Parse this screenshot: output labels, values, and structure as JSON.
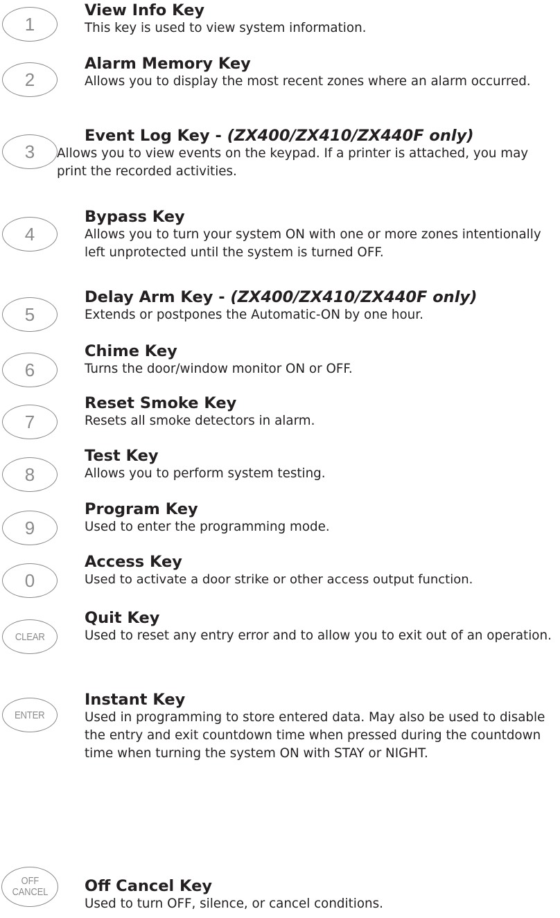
{
  "keys": [
    {
      "button": "1",
      "title": "View Info Key",
      "title_note": "",
      "description": "This key is used to view system information."
    },
    {
      "button": "2",
      "title": "Alarm Memory Key",
      "title_note": "",
      "description": "Allows you to display the most recent zones where an alarm occurred."
    },
    {
      "button": "3",
      "title": "Event Log Key - ",
      "title_note": "(ZX400/ZX410/ZX440F only)",
      "description": "Allows you to view events on the keypad. If a printer is attached, you may print the recorded activities."
    },
    {
      "button": "4",
      "title": "Bypass Key",
      "title_note": "",
      "description": "Allows you to turn your system ON with one or more zones intentionally left unprotected until the system is turned OFF."
    },
    {
      "button": "5",
      "title": "Delay Arm Key - ",
      "title_note": "(ZX400/ZX410/ZX440F only)",
      "description": "Extends or postpones the Automatic-ON by one hour."
    },
    {
      "button": "6",
      "title": "Chime Key",
      "title_note": "",
      "description": "Turns the door/window monitor ON or OFF."
    },
    {
      "button": "7",
      "title": "Reset Smoke Key",
      "title_note": "",
      "description": "Resets all smoke detectors in alarm."
    },
    {
      "button": "8",
      "title": "Test Key",
      "title_note": "",
      "description": "Allows you to perform system testing."
    },
    {
      "button": "9",
      "title": "Program Key",
      "title_note": "",
      "description": "Used to enter the programming mode."
    },
    {
      "button": "0",
      "title": "Access Key",
      "title_note": "",
      "description": "Used to activate a door strike or other access output function."
    },
    {
      "button": "CLEAR",
      "title": "Quit Key",
      "title_note": "",
      "description": "Used to reset any entry error and to allow you to exit out of an operation."
    },
    {
      "button": "ENTER",
      "title": "Instant Key",
      "title_note": "",
      "description": "Used in programming to store entered data.  May also be used to  disable the entry and exit countdown time when pressed during the countdown time when turning the system ON with STAY or NIGHT."
    },
    {
      "button": "OFF CANCEL",
      "button_lines": [
        "OFF",
        "CANCEL"
      ],
      "title": "Off Cancel Key",
      "title_note": "",
      "description": "Used to turn OFF, silence, or cancel conditions."
    }
  ]
}
